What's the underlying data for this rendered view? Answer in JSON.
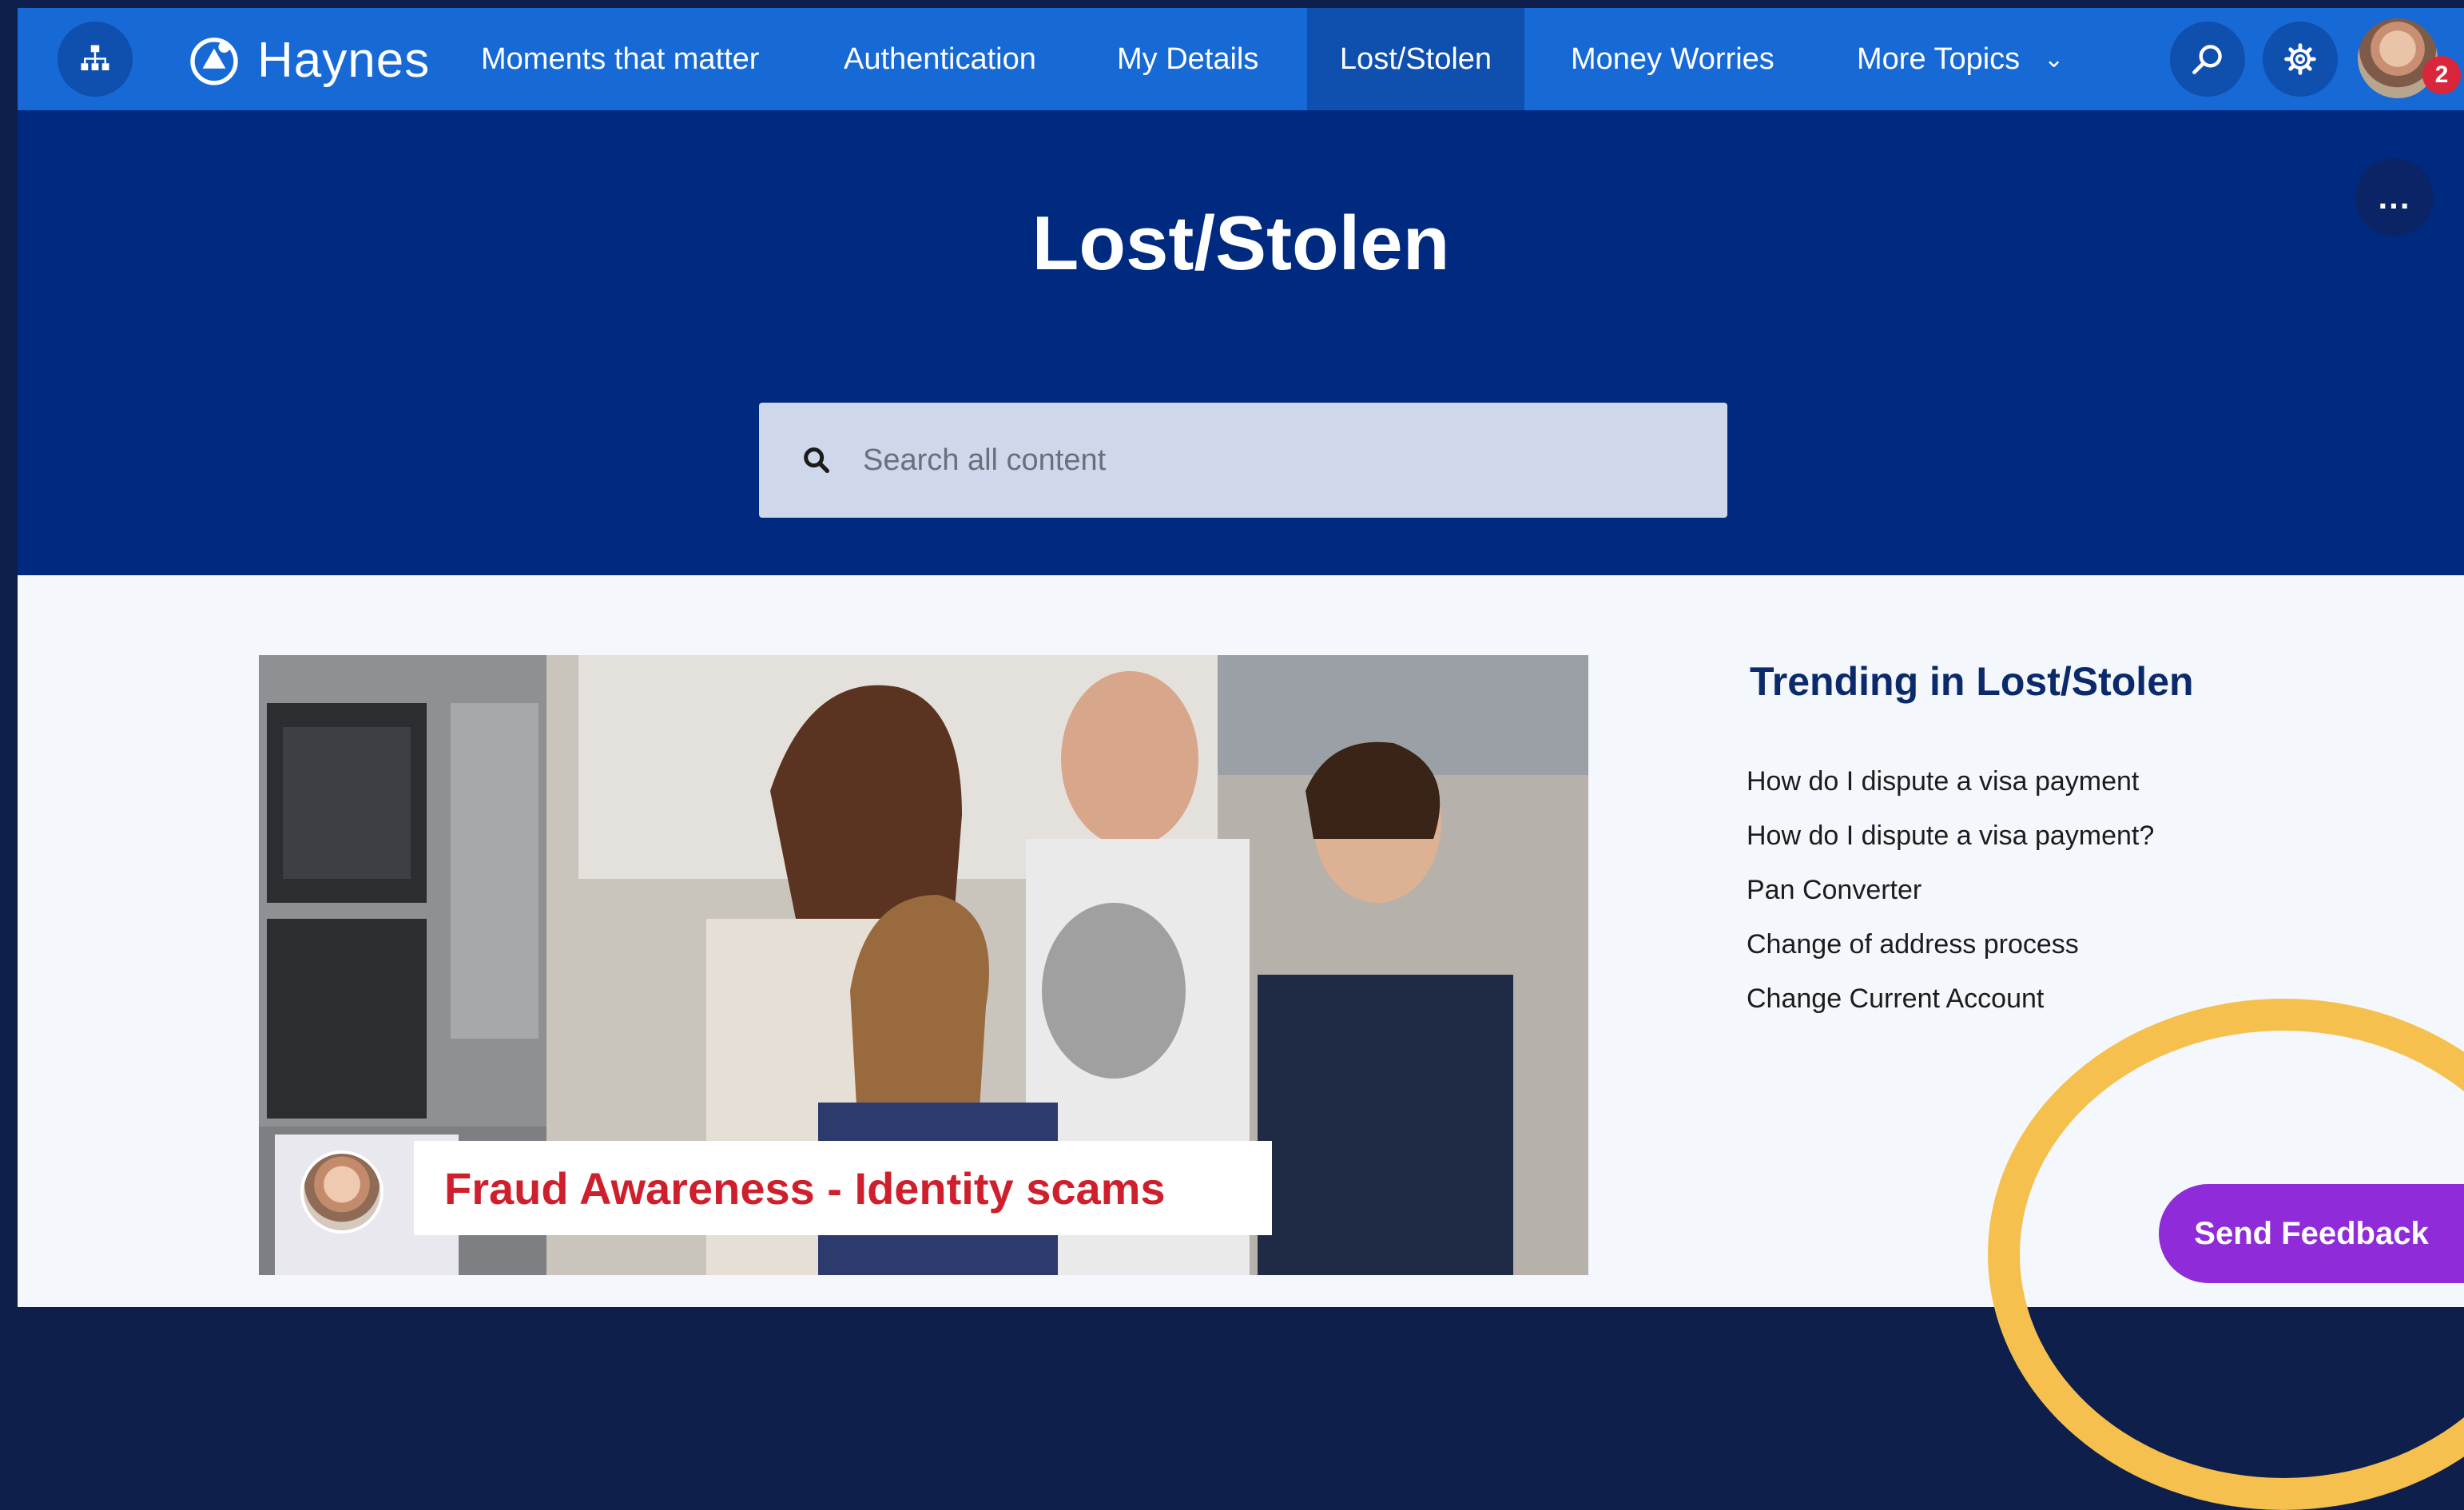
{
  "app": {
    "name": "Haynes"
  },
  "nav": {
    "items": [
      {
        "label": "Moments that matter"
      },
      {
        "label": "Authentication"
      },
      {
        "label": "My Details"
      },
      {
        "label": "Lost/Stolen",
        "active": true
      },
      {
        "label": "Money Worries"
      },
      {
        "label": "More Topics"
      }
    ],
    "notification_count": "2"
  },
  "hero": {
    "title": "Lost/Stolen",
    "more_label": "...",
    "search_placeholder": "Search all content"
  },
  "banner": {
    "caption": "Fraud Awareness - Identity scams"
  },
  "trending": {
    "title": "Trending in Lost/Stolen",
    "items": [
      "How do I dispute a visa payment",
      "How do I dispute a visa payment?",
      "Pan Converter",
      "Change of address process",
      "Change Current Account"
    ]
  },
  "feedback": {
    "label": "Send Feedback"
  },
  "colors": {
    "nav": "#1769d6",
    "hero": "#002a80",
    "accent_purple": "#8f2bd9",
    "highlight": "#f5c04d",
    "caption_red": "#cf1f2d"
  }
}
